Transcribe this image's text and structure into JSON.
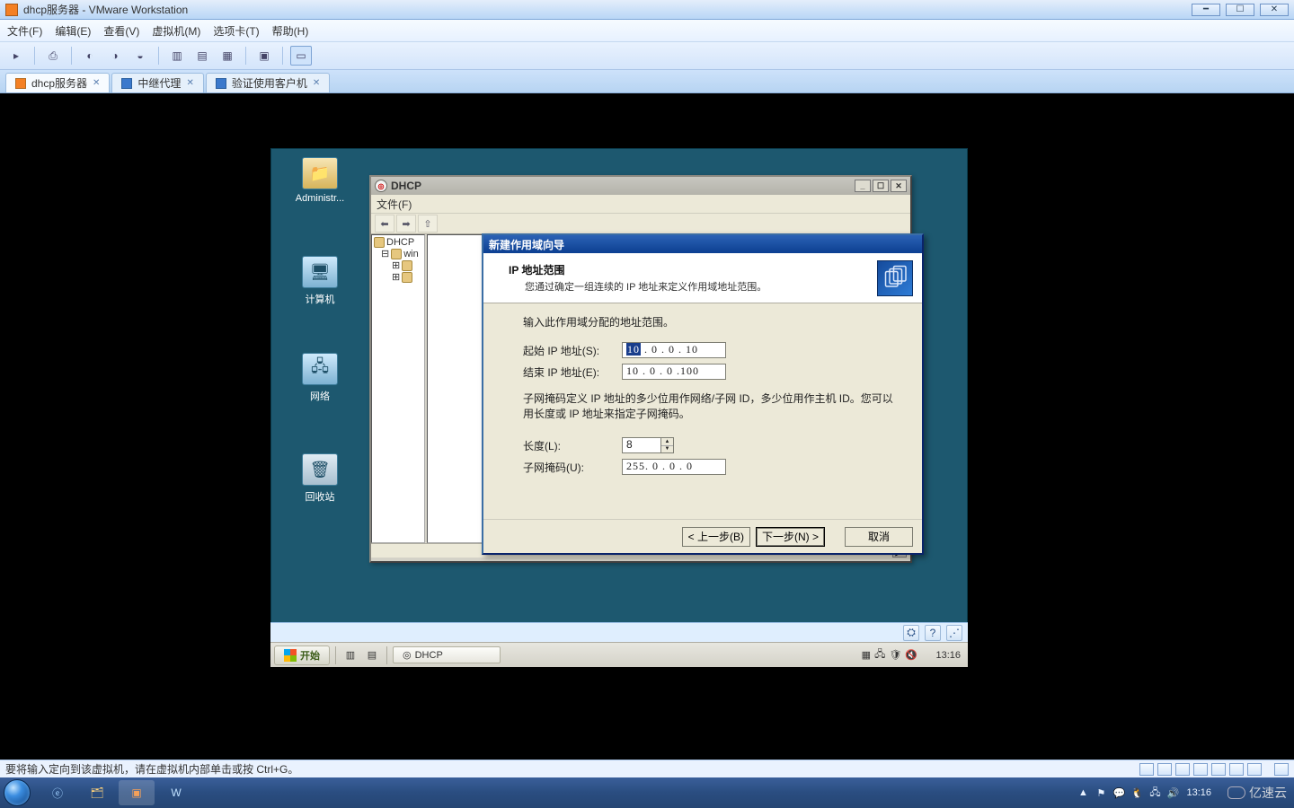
{
  "vmware": {
    "title": "dhcp服务器 - VMware Workstation",
    "menu": {
      "file": "文件(F)",
      "edit": "编辑(E)",
      "view": "查看(V)",
      "vm": "虚拟机(M)",
      "tabs": "选项卡(T)",
      "help": "帮助(H)"
    },
    "tabs": [
      {
        "label": "dhcp服务器",
        "active": true
      },
      {
        "label": "中继代理",
        "active": false
      },
      {
        "label": "验证使用客户机",
        "active": false
      }
    ],
    "statusbar_hint": "要将输入定向到该虚拟机，请在虚拟机内部单击或按 Ctrl+G。"
  },
  "vm_desktop": {
    "icons": {
      "admin": "Administr...",
      "computer": "计算机",
      "network": "网络",
      "recycle": "回收站"
    },
    "statusbar_icons": {
      "tools": "vmtools",
      "help": "?"
    },
    "taskbar": {
      "start": "开始",
      "task1": "DHCP",
      "clock": "13:16"
    }
  },
  "mmc": {
    "title": "DHCP",
    "menu": {
      "file": "文件(F)"
    },
    "tree": {
      "root": "DHCP",
      "server": "win"
    }
  },
  "wizard": {
    "title": "新建作用域向导",
    "header_title": "IP 地址范围",
    "header_sub": "您通过确定一组连续的 IP 地址来定义作用域地址范围。",
    "body_intro": "输入此作用域分配的地址范围。",
    "start_label": "起始 IP 地址(S):",
    "end_label": "结束 IP 地址(E):",
    "start_ip_sel": "10",
    "start_ip_rest": " .  0  .  0  . 10",
    "end_ip": "10 .  0  .  0  .100",
    "mask_note": "子网掩码定义 IP 地址的多少位用作网络/子网 ID，多少位用作主机 ID。您可以用长度或 IP 地址来指定子网掩码。",
    "len_label": "长度(L):",
    "len_value": "8",
    "mask_label": "子网掩码(U):",
    "mask_value": "255.  0  .  0  .  0",
    "btn_back": "< 上一步(B)",
    "btn_next": "下一步(N) >",
    "btn_cancel": "取消"
  },
  "host": {
    "time": "13:16",
    "date": "",
    "watermark": "亿速云"
  }
}
